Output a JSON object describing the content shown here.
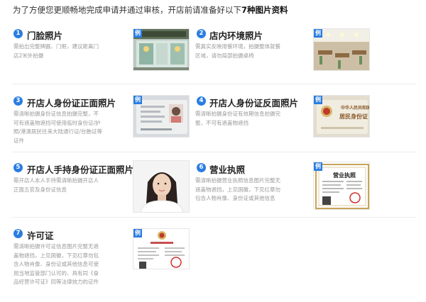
{
  "intro": {
    "prefix": "为了方便您更顺畅地完成申请并通过审核，开店前请准备好以下",
    "highlight": "7种图片资料"
  },
  "example_tag": "例",
  "items": [
    {
      "num": "1",
      "title": "门脸照片",
      "desc": "需拍出完整牌匾、门框，建议距离门店2米外拍摄",
      "thumb_icon": "storefront-photo"
    },
    {
      "num": "2",
      "title": "店内环境照片",
      "desc": "需真实反映用餐环境，拍摄整体就餐区域，请勿局部拍摄桌椅",
      "thumb_icon": "dining-room-photo"
    },
    {
      "num": "3",
      "title": "开店人身份证正面照片",
      "desc": "需清晰拍摄身份证信息拍摄完整，不可有遮盖物遮挡可使用临时身份证/护照/港澳居民往来大陆通行证/台胞证等证件",
      "thumb_icon": "id-card-front-photo"
    },
    {
      "num": "4",
      "title": "开店人身份证反面照片",
      "desc": "需清晰拍摄身份证有效期信息拍摄完整，不可有遮盖物遮挡",
      "thumb_icon": "id-card-back-photo",
      "caption_1": "中华人民共和国",
      "caption_2": "居民身份证"
    },
    {
      "num": "5",
      "title": "开店人手持身份证正面照片",
      "desc": "需开店人本人手持需清晰拍摄开店人正面五官及身份证信息",
      "thumb_icon": "holding-id-portrait-photo"
    },
    {
      "num": "6",
      "title": "营业执照",
      "desc": "需清晰拍摄营业执照信息图片完整无遮盖物遮挡，上见国徽，下见红章勿包含人物肖像、身份证或其他信息",
      "thumb_icon": "business-license-photo",
      "caption_1": "营业执照"
    },
    {
      "num": "7",
      "title": "许可证",
      "desc": "需清晰拍摄许可证信息图片完整无遮盖物遮挡，上见国徽，下见红章勿包含人物肖像、身份证或其他信息可使用当地监管部门认可的、具有同《食品经营许可证》同等法律效力的证件",
      "thumb_icon": "food-permit-photo"
    }
  ],
  "colors": {
    "accent": "#2a7de1",
    "text": "#333333",
    "muted": "#999999"
  }
}
